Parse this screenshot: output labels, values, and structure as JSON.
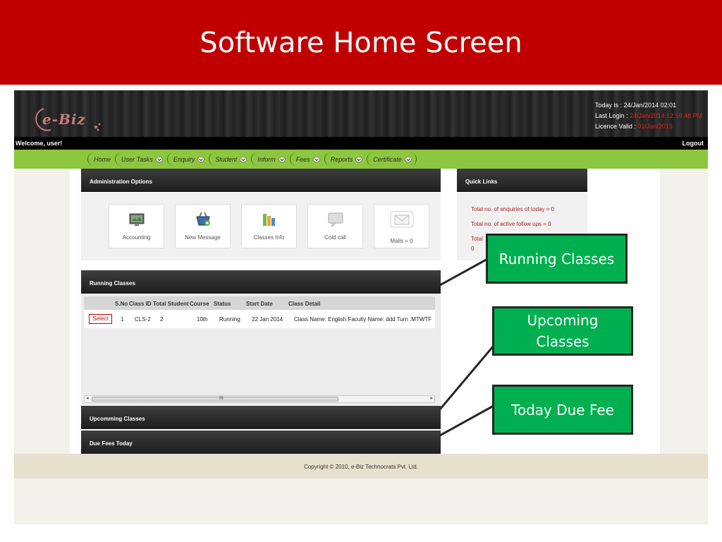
{
  "slide": {
    "title": "Software Home Screen",
    "callouts": {
      "running": "Running Classes",
      "upcoming": "Upcoming Classes",
      "due": "Today Due Fee"
    }
  },
  "header": {
    "logo_text": "e-Biz",
    "today_label": "Today is : ",
    "today_value": "24/Jan/2014 02:01",
    "last_login_label": "Last Login : ",
    "last_login_value": "24/Jan/2014 12:59:48 PM",
    "licence_label": "Licence Valid : ",
    "licence_value": "01/Jan/2015",
    "welcome": "Welcome,  user!",
    "logout": "Logout"
  },
  "nav": [
    "Home",
    "User Tasks",
    "Enquiry",
    "Student",
    "Inform",
    "Fees",
    "Reports",
    "Certificate"
  ],
  "admin": {
    "title": "Administration Options",
    "tiles": [
      "Accounting",
      "New Message",
      "Classes Info",
      "Cold call",
      "Mails = 0"
    ]
  },
  "quick_links": {
    "title": "Quick Links",
    "items": [
      "Total no. of enquiries of today = 0",
      "Total no. of active follow ups = 0",
      "Total",
      "0"
    ]
  },
  "running_classes": {
    "title": "Running Classes",
    "columns": [
      "S.No",
      "Class ID",
      "Total Student",
      "Course",
      "Status",
      "Start Date",
      "Class Detail"
    ],
    "row": {
      "action": "Select",
      "sno": "1",
      "class_id": "CLS-2",
      "total_student": "2",
      "course": "10th",
      "status": "Running",
      "start_date": "22 Jan 2014",
      "class_detail": "Class Name: English Faculty Name: ddd Turn :MTWTF"
    },
    "scroll_grip": "III"
  },
  "upcoming_title": "Upcomming Classes",
  "due_fees_title": "Due Fees Today",
  "footer": "Copyright © 2010, e-Biz Technocrats Pvt. Ltd.",
  "colors": {
    "banner": "#c00000",
    "nav": "#8dc63f",
    "callout": "#00b050",
    "alert_text": "#e02020"
  }
}
